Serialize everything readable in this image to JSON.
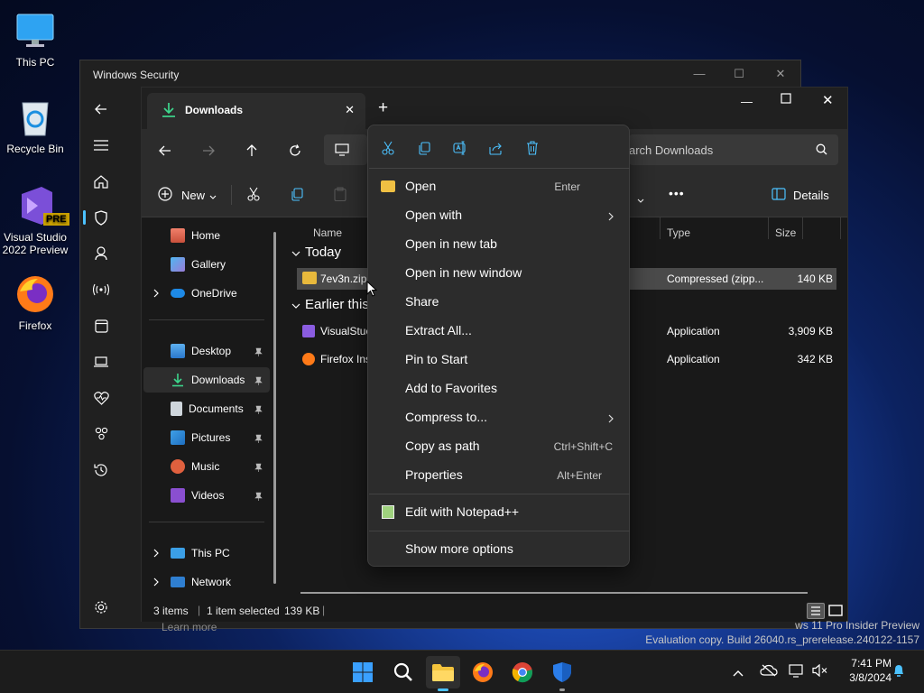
{
  "desktop": {
    "icons": [
      {
        "label": "This PC"
      },
      {
        "label": "Recycle Bin"
      },
      {
        "label": "Visual Studio 2022 Preview",
        "badge": "PRE"
      },
      {
        "label": "Firefox"
      }
    ]
  },
  "windows_security": {
    "title": "Windows Security",
    "below_text": "Learn more",
    "nav_icons": [
      "back-icon",
      "menu-icon",
      "home-icon",
      "shield-icon",
      "person-icon",
      "wireless-icon",
      "app-browser-icon",
      "device-icon",
      "health-icon",
      "family-icon",
      "history-icon",
      "settings-icon"
    ]
  },
  "explorer": {
    "tab_title": "Downloads",
    "new_tab": "+",
    "search_placeholder": "Search Downloads",
    "search_visible": "arch Downloads",
    "toolbar": {
      "new_label": "New",
      "more": "•••",
      "details_label": "Details"
    },
    "nav": {
      "home": "Home",
      "gallery": "Gallery",
      "onedrive": "OneDrive",
      "desktop": "Desktop",
      "downloads": "Downloads",
      "documents": "Documents",
      "pictures": "Pictures",
      "music": "Music",
      "videos": "Videos",
      "thispc": "This PC",
      "network": "Network"
    },
    "columns": {
      "name": "Name",
      "type": "Type",
      "size": "Size"
    },
    "groups": {
      "today": "Today",
      "earlier": "Earlier this"
    },
    "files": [
      {
        "name": "7ev3n.zip",
        "type": "Compressed (zipp...",
        "size": "140 KB",
        "selected": true
      },
      {
        "name": "VisualStuc",
        "type": "Application",
        "size": "3,909 KB"
      },
      {
        "name": "Firefox Ins",
        "type": "Application",
        "size": "342 KB"
      }
    ],
    "status": {
      "items": "3 items",
      "selected": "1 item selected",
      "size": "139 KB"
    }
  },
  "context_menu": {
    "top_icons": [
      "cut-icon",
      "copy-icon",
      "rename-icon",
      "share-icon",
      "delete-icon"
    ],
    "items": [
      {
        "label": "Open",
        "accel": "Enter"
      },
      {
        "label": "Open with",
        "accel": ""
      },
      {
        "label": "Open in new tab",
        "accel": ""
      },
      {
        "label": "Open in new window",
        "accel": ""
      },
      {
        "label": "Share",
        "accel": ""
      },
      {
        "label": "Extract All...",
        "accel": ""
      },
      {
        "label": "Pin to Start",
        "accel": ""
      },
      {
        "label": "Add to Favorites",
        "accel": ""
      },
      {
        "label": "Compress to...",
        "accel": ""
      },
      {
        "label": "Copy as path",
        "accel": "Ctrl+Shift+C"
      },
      {
        "label": "Properties",
        "accel": "Alt+Enter"
      },
      {
        "label": "Edit with Notepad++",
        "accel": ""
      },
      {
        "label": "Show more options",
        "accel": ""
      }
    ]
  },
  "watermark": {
    "line1": "ws 11 Pro Insider Preview",
    "line2": "Evaluation copy. Build 26040.rs_prerelease.240122-1157"
  },
  "taskbar": {
    "apps": [
      "start-icon",
      "search-icon",
      "file-explorer-icon",
      "firefox-icon",
      "chrome-icon",
      "defender-icon"
    ],
    "time": "7:41 PM",
    "date": "3/8/2024"
  },
  "colors": {
    "accent": "#4cc2ff",
    "selection": "#4a4a4a",
    "desktop_blue": "#1a44a8"
  }
}
